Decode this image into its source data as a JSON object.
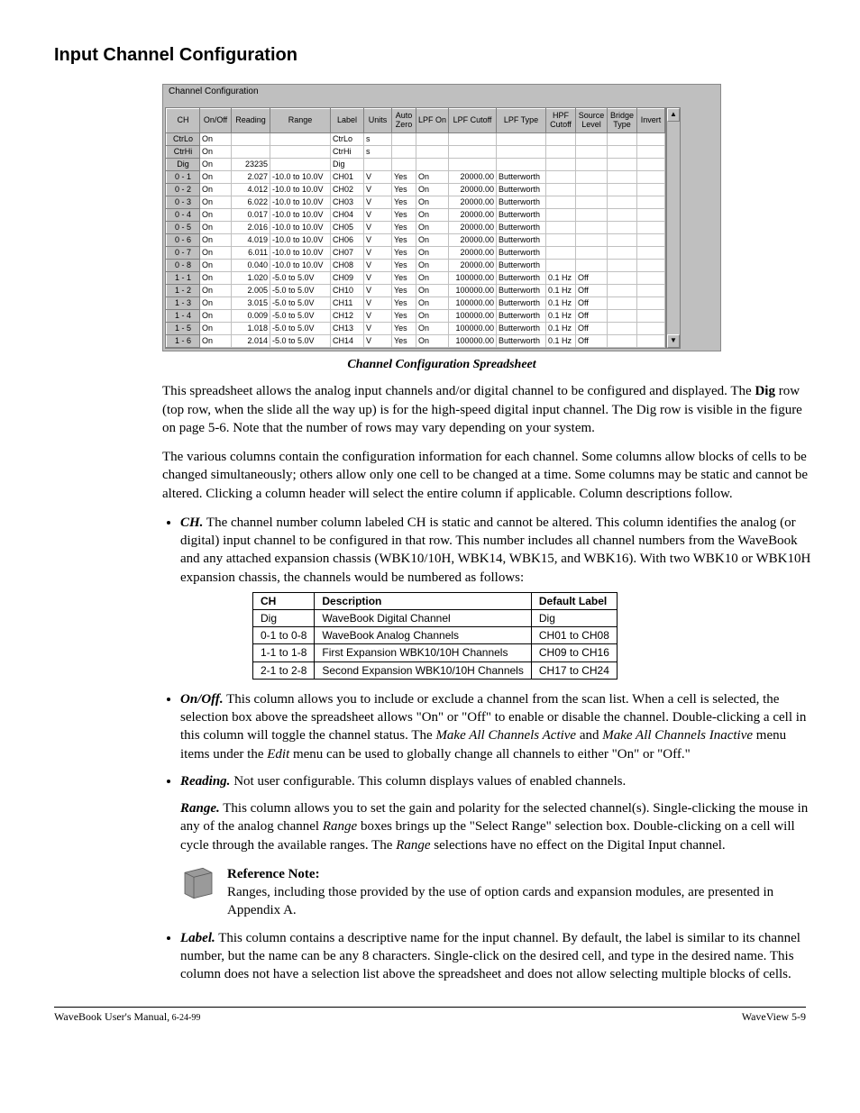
{
  "heading": "Input Channel Configuration",
  "ss": {
    "title": "Channel Configuration",
    "headers": [
      "CH",
      "On/Off",
      "Reading",
      "Range",
      "Label",
      "Units",
      "Auto\nZero",
      "LPF On",
      "LPF Cutoff",
      "LPF Type",
      "HPF\nCutoff",
      "Source\nLevel",
      "Bridge\nType",
      "Invert"
    ],
    "rows": [
      {
        "ch": "CtrLo",
        "on": "On",
        "rd": "",
        "rg": "",
        "lb": "CtrLo",
        "un": "s",
        "az": "",
        "lo": "",
        "lc": "",
        "lt": "",
        "hc": "",
        "sl": "",
        "bt": "",
        "iv": ""
      },
      {
        "ch": "CtrHi",
        "on": "On",
        "rd": "",
        "rg": "",
        "lb": "CtrHi",
        "un": "s",
        "az": "",
        "lo": "",
        "lc": "",
        "lt": "",
        "hc": "",
        "sl": "",
        "bt": "",
        "iv": ""
      },
      {
        "ch": "Dig",
        "on": "On",
        "rd": "23235",
        "rg": "",
        "lb": "Dig",
        "un": "",
        "az": "",
        "lo": "",
        "lc": "",
        "lt": "",
        "hc": "",
        "sl": "",
        "bt": "",
        "iv": ""
      },
      {
        "ch": "0 - 1",
        "on": "On",
        "rd": "2.027",
        "rg": "-10.0 to 10.0V",
        "lb": "CH01",
        "un": "V",
        "az": "Yes",
        "lo": "On",
        "lc": "20000.00",
        "lt": "Butterworth",
        "hc": "",
        "sl": "",
        "bt": "",
        "iv": ""
      },
      {
        "ch": "0 - 2",
        "on": "On",
        "rd": "4.012",
        "rg": "-10.0 to 10.0V",
        "lb": "CH02",
        "un": "V",
        "az": "Yes",
        "lo": "On",
        "lc": "20000.00",
        "lt": "Butterworth",
        "hc": "",
        "sl": "",
        "bt": "",
        "iv": ""
      },
      {
        "ch": "0 - 3",
        "on": "On",
        "rd": "6.022",
        "rg": "-10.0 to 10.0V",
        "lb": "CH03",
        "un": "V",
        "az": "Yes",
        "lo": "On",
        "lc": "20000.00",
        "lt": "Butterworth",
        "hc": "",
        "sl": "",
        "bt": "",
        "iv": ""
      },
      {
        "ch": "0 - 4",
        "on": "On",
        "rd": "0.017",
        "rg": "-10.0 to 10.0V",
        "lb": "CH04",
        "un": "V",
        "az": "Yes",
        "lo": "On",
        "lc": "20000.00",
        "lt": "Butterworth",
        "hc": "",
        "sl": "",
        "bt": "",
        "iv": ""
      },
      {
        "ch": "0 - 5",
        "on": "On",
        "rd": "2.016",
        "rg": "-10.0 to 10.0V",
        "lb": "CH05",
        "un": "V",
        "az": "Yes",
        "lo": "On",
        "lc": "20000.00",
        "lt": "Butterworth",
        "hc": "",
        "sl": "",
        "bt": "",
        "iv": ""
      },
      {
        "ch": "0 - 6",
        "on": "On",
        "rd": "4.019",
        "rg": "-10.0 to 10.0V",
        "lb": "CH06",
        "un": "V",
        "az": "Yes",
        "lo": "On",
        "lc": "20000.00",
        "lt": "Butterworth",
        "hc": "",
        "sl": "",
        "bt": "",
        "iv": ""
      },
      {
        "ch": "0 - 7",
        "on": "On",
        "rd": "6.011",
        "rg": "-10.0 to 10.0V",
        "lb": "CH07",
        "un": "V",
        "az": "Yes",
        "lo": "On",
        "lc": "20000.00",
        "lt": "Butterworth",
        "hc": "",
        "sl": "",
        "bt": "",
        "iv": ""
      },
      {
        "ch": "0 - 8",
        "on": "On",
        "rd": "0.040",
        "rg": "-10.0 to 10.0V",
        "lb": "CH08",
        "un": "V",
        "az": "Yes",
        "lo": "On",
        "lc": "20000.00",
        "lt": "Butterworth",
        "hc": "",
        "sl": "",
        "bt": "",
        "iv": ""
      },
      {
        "ch": "1 - 1",
        "on": "On",
        "rd": "1.020",
        "rg": "-5.0 to 5.0V",
        "lb": "CH09",
        "un": "V",
        "az": "Yes",
        "lo": "On",
        "lc": "100000.00",
        "lt": "Butterworth",
        "hc": "0.1 Hz",
        "sl": "Off",
        "bt": "",
        "iv": ""
      },
      {
        "ch": "1 - 2",
        "on": "On",
        "rd": "2.005",
        "rg": "-5.0 to 5.0V",
        "lb": "CH10",
        "un": "V",
        "az": "Yes",
        "lo": "On",
        "lc": "100000.00",
        "lt": "Butterworth",
        "hc": "0.1 Hz",
        "sl": "Off",
        "bt": "",
        "iv": ""
      },
      {
        "ch": "1 - 3",
        "on": "On",
        "rd": "3.015",
        "rg": "-5.0 to 5.0V",
        "lb": "CH11",
        "un": "V",
        "az": "Yes",
        "lo": "On",
        "lc": "100000.00",
        "lt": "Butterworth",
        "hc": "0.1 Hz",
        "sl": "Off",
        "bt": "",
        "iv": ""
      },
      {
        "ch": "1 - 4",
        "on": "On",
        "rd": "0.009",
        "rg": "-5.0 to 5.0V",
        "lb": "CH12",
        "un": "V",
        "az": "Yes",
        "lo": "On",
        "lc": "100000.00",
        "lt": "Butterworth",
        "hc": "0.1 Hz",
        "sl": "Off",
        "bt": "",
        "iv": ""
      },
      {
        "ch": "1 - 5",
        "on": "On",
        "rd": "1.018",
        "rg": "-5.0 to 5.0V",
        "lb": "CH13",
        "un": "V",
        "az": "Yes",
        "lo": "On",
        "lc": "100000.00",
        "lt": "Butterworth",
        "hc": "0.1 Hz",
        "sl": "Off",
        "bt": "",
        "iv": ""
      },
      {
        "ch": "1 - 6",
        "on": "On",
        "rd": "2.014",
        "rg": "-5.0 to 5.0V",
        "lb": "CH14",
        "un": "V",
        "az": "Yes",
        "lo": "On",
        "lc": "100000.00",
        "lt": "Butterworth",
        "hc": "0.1 Hz",
        "sl": "Off",
        "bt": "",
        "iv": ""
      }
    ]
  },
  "caption": "Channel Configuration Spreadsheet",
  "para1a": "This spreadsheet allows the analog input channels and/or digital channel to be configured and displayed. The ",
  "para1b": "Dig",
  "para1c": " row (top row, when the slide all the way up) is for the high-speed digital input channel.  The Dig row is visible in the figure on page 5-6.  Note that the number of rows may vary depending on your system.",
  "para2": "The various columns contain the configuration information for each channel. Some columns allow blocks of cells to be changed simultaneously; others allow only one cell to be changed at a time. Some columns may be static and cannot be altered. Clicking a column header will select the entire column if applicable. Column descriptions follow.",
  "ch_desc": " The channel number column labeled CH is static and cannot be altered. This column identifies the analog (or digital) input channel to be configured in that row. This number includes all channel numbers from the WaveBook and any attached expansion chassis (WBK10/10H, WBK14, WBK15, and WBK16).  With two WBK10 or WBK10H expansion chassis, the channels would be numbered as follows:",
  "inner": {
    "h1": "CH",
    "h2": "Description",
    "h3": "Default Label",
    "rows": [
      [
        "Dig",
        "WaveBook Digital Channel",
        "Dig"
      ],
      [
        "0-1 to 0-8",
        "WaveBook Analog Channels",
        "CH01 to CH08"
      ],
      [
        "1-1 to 1-8",
        "First Expansion WBK10/10H Channels",
        "CH09 to CH16"
      ],
      [
        "2-1 to 2-8",
        "Second Expansion WBK10/10H Channels",
        "CH17 to CH24"
      ]
    ]
  },
  "onoff_a": " This column allows you to include or exclude a channel from the scan list. When a cell is selected, the selection box above the spreadsheet allows \"On\" or \"Off\" to enable or disable the channel. Double-clicking a cell in this column will toggle the channel status. The ",
  "onoff_b": "Make All Channels Active",
  "onoff_c": " and ",
  "onoff_d": "Make All Channels Inactive",
  "onoff_e": " menu items under the ",
  "onoff_f": "Edit",
  "onoff_g": " menu can be used to globally change all channels to either \"On\" or \"Off.\"",
  "reading": " Not user configurable.  This column displays values of enabled channels.",
  "range_a": " This column allows you to set the gain and polarity for the selected channel(s). Single-clicking the mouse in any of the analog channel ",
  "range_b": "Range",
  "range_c": " boxes brings up the \"Select Range\" selection box. Double-clicking on a cell will cycle through the available ranges. The ",
  "range_d": "Range",
  "range_e": " selections have no effect on the Digital Input channel.",
  "ref_title": "Reference Note:",
  "ref_body": "Ranges, including those provided by the use of option cards and expansion modules, are presented in Appendix A.",
  "label_desc": " This column contains a descriptive name for the input channel. By default, the label is similar to its channel number, but the name can be any 8 characters. Single-click on the desired cell, and type in the desired name. This column does not have a selection list above the spreadsheet and does not allow selecting multiple blocks of cells.",
  "foot_l1": "WaveBook User's Manual,",
  "foot_l2": " 6-24-99",
  "foot_r": "WaveView    5-9",
  "terms": {
    "ch": "CH.",
    "onoff": "On/Off.",
    "reading": "Reading.",
    "range": "Range.",
    "label": "Label."
  }
}
